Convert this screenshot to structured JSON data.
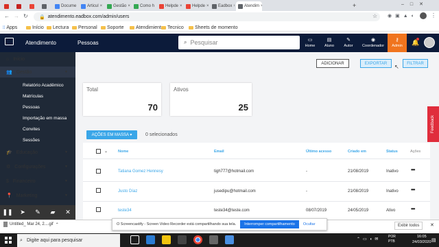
{
  "browser": {
    "tabs": [
      {
        "label": "",
        "color": "#d93025"
      },
      {
        "label": "",
        "color": "#c5221f"
      },
      {
        "label": "",
        "color": "#ea4335"
      },
      {
        "label": "",
        "color": "#5f6368"
      },
      {
        "label": "Docume",
        "color": "#4285f4"
      },
      {
        "label": "Articul",
        "color": "#4285f4"
      },
      {
        "label": "Gestão",
        "color": "#34a853"
      },
      {
        "label": "Como h",
        "color": "#34a853"
      },
      {
        "label": "Helpde",
        "color": "#ea4335"
      },
      {
        "label": "Helpde",
        "color": "#ea4335"
      },
      {
        "label": "Eadbox",
        "color": "#5f6368"
      },
      {
        "label": "Atendim",
        "color": "#5f6368"
      }
    ],
    "url": "atendimento.eadbox.com/admin/users",
    "bookmarks": [
      "Apps",
      "Início",
      "Lectura",
      "Personal",
      "Soporte",
      "Atendimiento",
      "Tecnico",
      "Sheets de momento"
    ]
  },
  "header": {
    "title": "Atendimento",
    "section": "Pessoas",
    "search_placeholder": "Pesquisar",
    "nav": [
      "Home",
      "Aluno",
      "Autor",
      "Coordenador",
      "Admin"
    ],
    "accent": "#f0741e",
    "bg": "#0c1b3a"
  },
  "sidebar": {
    "items": [
      {
        "label": "Início"
      },
      {
        "label": "Gestão"
      },
      {
        "label": "Educação"
      },
      {
        "label": "Configurações"
      },
      {
        "label": "Financeiro"
      },
      {
        "label": "Marketing"
      }
    ],
    "sub_items": [
      "Relatório Acadêmico",
      "Matrículas",
      "Pessoas",
      "Importação em massa",
      "Convites",
      "Sessões"
    ]
  },
  "actions": {
    "adicionar": "ADICIONAR",
    "exportar": "EXPORTAR",
    "filtrar": "FILTRAR"
  },
  "cards": [
    {
      "label": "Total",
      "value": "70"
    },
    {
      "label": "Ativos",
      "value": "25"
    }
  ],
  "bulk": {
    "label": "AÇÕES EM MASSA ▾",
    "selected": "0 selecionados"
  },
  "table": {
    "headers": [
      "Nome",
      "Email",
      "Último acesso",
      "Criado em",
      "Status",
      "Ações"
    ],
    "rows": [
      {
        "name": "Tatiana Gomez Hennesy",
        "email": "tigh777@hotmail.com",
        "last": "-",
        "created": "21/08/2019",
        "status": "Inativo"
      },
      {
        "name": "Justo Díaz",
        "email": "jusedipu@hotmail.com",
        "last": "-",
        "created": "21/08/2019",
        "status": "Inativo"
      },
      {
        "name": "teste34",
        "email": "teste34@teste.com",
        "last": "08/07/2019",
        "created": "24/05/2019",
        "status": "Ativo"
      }
    ]
  },
  "feedback": "Feedback",
  "download": {
    "file": "Untitled_ Mar 24, 2....gif",
    "show_all": "Exibir todos"
  },
  "notice": {
    "text": "O Screencastify - Screen Video Recorder está compartilhando sua tela.",
    "button": "Interromper compartilhamento",
    "hide": "Ocultar"
  },
  "taskbar": {
    "search": "Digite aqui para pesquisar",
    "lang1": "POR",
    "lang2": "PTB",
    "time": "16:05",
    "date": "24/03/2020"
  }
}
